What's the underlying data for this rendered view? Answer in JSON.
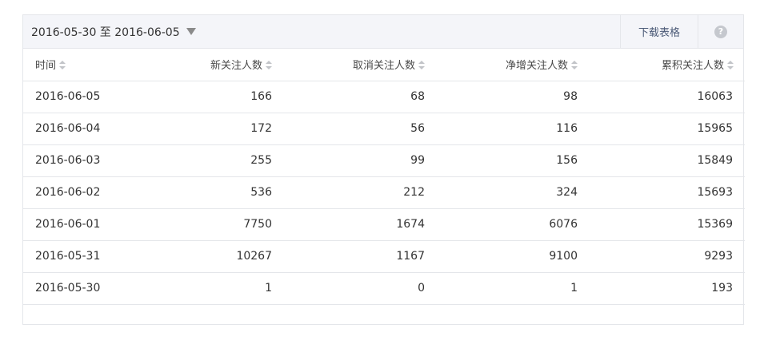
{
  "toolbar": {
    "date_range_label": "2016-05-30 至 2016-06-05",
    "download_label": "下载表格",
    "help_label": "?"
  },
  "table": {
    "columns": [
      "时间",
      "新关注人数",
      "取消关注人数",
      "净增关注人数",
      "累积关注人数"
    ],
    "rows": [
      [
        "2016-06-05",
        "166",
        "68",
        "98",
        "16063"
      ],
      [
        "2016-06-04",
        "172",
        "56",
        "116",
        "15965"
      ],
      [
        "2016-06-03",
        "255",
        "99",
        "156",
        "15849"
      ],
      [
        "2016-06-02",
        "536",
        "212",
        "324",
        "15693"
      ],
      [
        "2016-06-01",
        "7750",
        "1674",
        "6076",
        "15369"
      ],
      [
        "2016-05-31",
        "10267",
        "1167",
        "9100",
        "9293"
      ],
      [
        "2016-05-30",
        "1",
        "0",
        "1",
        "193"
      ]
    ]
  },
  "colors": {
    "toolbar_bg": "#f4f5f9",
    "border": "#e4e6ea",
    "link": "#4b5a77"
  }
}
